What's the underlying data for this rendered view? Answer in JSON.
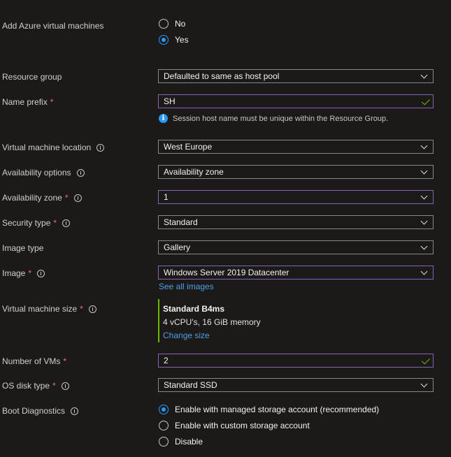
{
  "add_vms": {
    "label": "Add Azure virtual machines",
    "options": [
      "No",
      "Yes"
    ],
    "selected": "Yes"
  },
  "resource_group": {
    "label": "Resource group",
    "value": "Defaulted to same as host pool"
  },
  "name_prefix": {
    "label": "Name prefix",
    "value": "SH",
    "note": "Session host name must be unique within the Resource Group."
  },
  "vm_location": {
    "label": "Virtual machine location",
    "value": "West Europe"
  },
  "availability_options": {
    "label": "Availability options",
    "value": "Availability zone"
  },
  "availability_zone": {
    "label": "Availability zone",
    "value": "1"
  },
  "security_type": {
    "label": "Security type",
    "value": "Standard"
  },
  "image_type": {
    "label": "Image type",
    "value": "Gallery"
  },
  "image": {
    "label": "Image",
    "value": "Windows Server 2019 Datacenter",
    "see_all": "See all images"
  },
  "vm_size": {
    "label": "Virtual machine size",
    "name": "Standard B4ms",
    "spec": "4 vCPU's, 16 GiB memory",
    "change": "Change size"
  },
  "num_vms": {
    "label": "Number of VMs",
    "value": "2"
  },
  "os_disk": {
    "label": "OS disk type",
    "value": "Standard SSD"
  },
  "boot_diag": {
    "label": "Boot Diagnostics",
    "options": [
      "Enable with managed storage account (recommended)",
      "Enable with custom storage account",
      "Disable"
    ],
    "selected": "Enable with managed storage account (recommended)"
  },
  "required_mark": "*",
  "colors": {
    "background": "#1b1a19",
    "accent": "#2899f5",
    "focus_border": "#8764b8",
    "valid": "#6bb700",
    "required": "#f1707b"
  }
}
